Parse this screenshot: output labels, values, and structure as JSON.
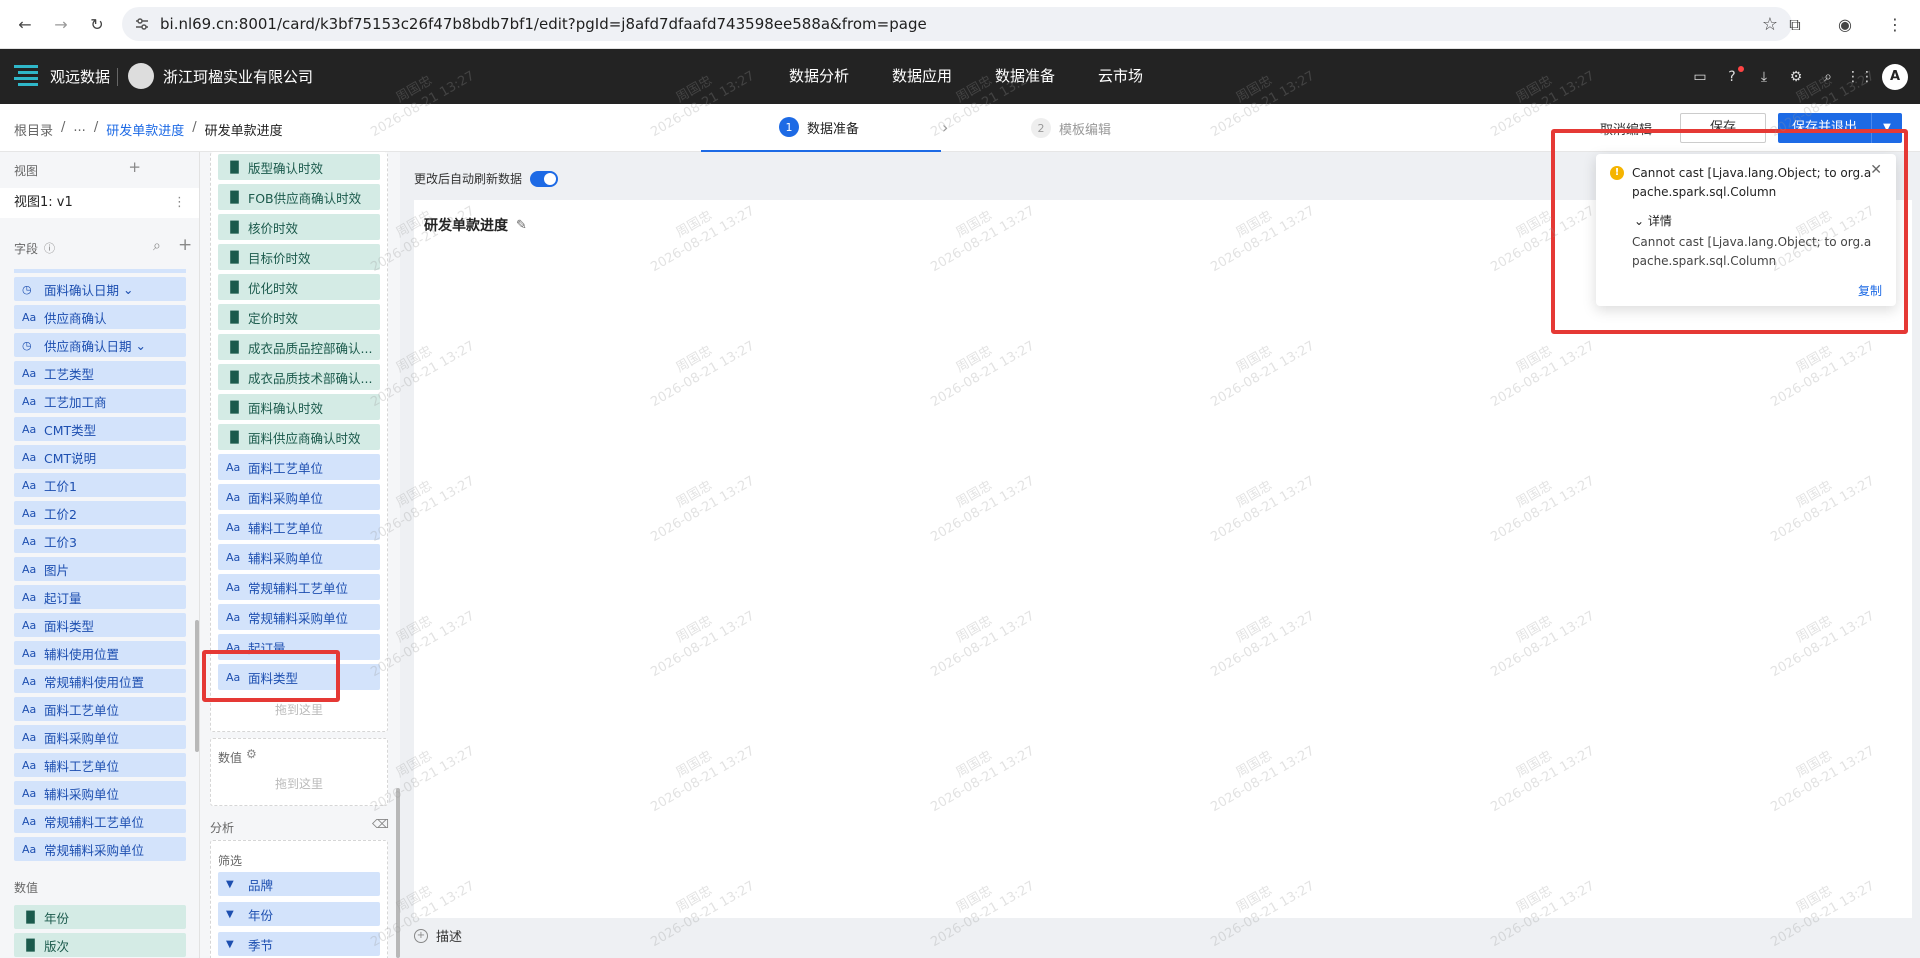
{
  "browser": {
    "url": "bi.nl69.cn:8001/card/k3bf75153c26f47b8bdb7bf1/edit?pgId=j8afd7dfaafd743598ee588a&from=page"
  },
  "header": {
    "brand": "观远数据",
    "company": "浙江珂楹实业有限公司",
    "nav": [
      "数据分析",
      "数据应用",
      "数据准备",
      "云市场"
    ]
  },
  "subbar": {
    "breadcrumbs": [
      "根目录",
      "...",
      "研发单款进度",
      "研发单款进度"
    ],
    "steps": [
      {
        "num": "1",
        "label": "数据准备"
      },
      {
        "num": "2",
        "label": "模板编辑"
      }
    ],
    "cancel": "取消编辑",
    "save": "保存",
    "save_exit": "保存并退出"
  },
  "left": {
    "view_title": "视图",
    "view_item": "视图1: v1",
    "fields_title": "字段",
    "values_title": "数值",
    "fields": [
      {
        "tag": "date",
        "label": "面料确认日期"
      },
      {
        "tag": "Aa",
        "label": "供应商确认"
      },
      {
        "tag": "date",
        "label": "供应商确认日期"
      },
      {
        "tag": "Aa",
        "label": "工艺类型"
      },
      {
        "tag": "Aa",
        "label": "工艺加工商"
      },
      {
        "tag": "Aa",
        "label": "CMT类型"
      },
      {
        "tag": "Aa",
        "label": "CMT说明"
      },
      {
        "tag": "Aa",
        "label": "工价1"
      },
      {
        "tag": "Aa",
        "label": "工价2"
      },
      {
        "tag": "Aa",
        "label": "工价3"
      },
      {
        "tag": "Aa",
        "label": "图片"
      },
      {
        "tag": "Aa",
        "label": "起订量"
      },
      {
        "tag": "Aa",
        "label": "面料类型"
      },
      {
        "tag": "Aa",
        "label": "辅料使用位置"
      },
      {
        "tag": "Aa",
        "label": "常规辅料使用位置"
      },
      {
        "tag": "Aa",
        "label": "面料工艺单位"
      },
      {
        "tag": "Aa",
        "label": "面料采购单位"
      },
      {
        "tag": "Aa",
        "label": "辅料工艺单位"
      },
      {
        "tag": "Aa",
        "label": "辅料采购单位"
      },
      {
        "tag": "Aa",
        "label": "常规辅料工艺单位"
      },
      {
        "tag": "Aa",
        "label": "常规辅料采购单位"
      }
    ],
    "values": [
      {
        "tag": "bar",
        "label": "年份"
      },
      {
        "tag": "bar",
        "label": "版次"
      }
    ]
  },
  "middle": {
    "dims": [
      {
        "tag": "bar",
        "label": "版型确认时效"
      },
      {
        "tag": "bar",
        "label": "FOB供应商确认时效"
      },
      {
        "tag": "bar",
        "label": "核价时效"
      },
      {
        "tag": "bar",
        "label": "目标价时效"
      },
      {
        "tag": "bar",
        "label": "优化时效"
      },
      {
        "tag": "bar",
        "label": "定价时效"
      },
      {
        "tag": "bar",
        "label": "成衣品质品控部确认..."
      },
      {
        "tag": "bar",
        "label": "成衣品质技术部确认..."
      },
      {
        "tag": "bar",
        "label": "面料确认时效"
      },
      {
        "tag": "bar",
        "label": "面料供应商确认时效"
      },
      {
        "tag": "Aa",
        "label": "面料工艺单位"
      },
      {
        "tag": "Aa",
        "label": "面料采购单位"
      },
      {
        "tag": "Aa",
        "label": "辅料工艺单位"
      },
      {
        "tag": "Aa",
        "label": "辅料采购单位"
      },
      {
        "tag": "Aa",
        "label": "常规辅料工艺单位"
      },
      {
        "tag": "Aa",
        "label": "常规辅料采购单位"
      },
      {
        "tag": "Aa",
        "label": "起订量"
      },
      {
        "tag": "Aa",
        "label": "面料类型"
      }
    ],
    "drop_hint": "拖到这里",
    "values_label": "数值",
    "analysis_label": "分析",
    "filter_label": "筛选",
    "filters": [
      "品牌",
      "年份",
      "季节"
    ]
  },
  "canvas": {
    "auto_refresh": "更改后自动刷新数据",
    "chart_title": "研发单款进度",
    "desc": "描述"
  },
  "notification": {
    "message": "Cannot cast [Ljava.lang.Object; to org.apache.spark.sql.Column",
    "detail_label": "详情",
    "detail": "Cannot cast [Ljava.lang.Object; to org.apache.spark.sql.Column",
    "copy": "复制"
  },
  "watermark": {
    "name": "周国忠",
    "time": "2026-08-21 13:27"
  },
  "colors": {
    "accent": "#1d6ae5",
    "header_bg": "#232323",
    "dim_field": "#d3e3fb",
    "measure_field": "#d4ebe5",
    "highlight": "#e53935",
    "warning": "#f5b400"
  }
}
